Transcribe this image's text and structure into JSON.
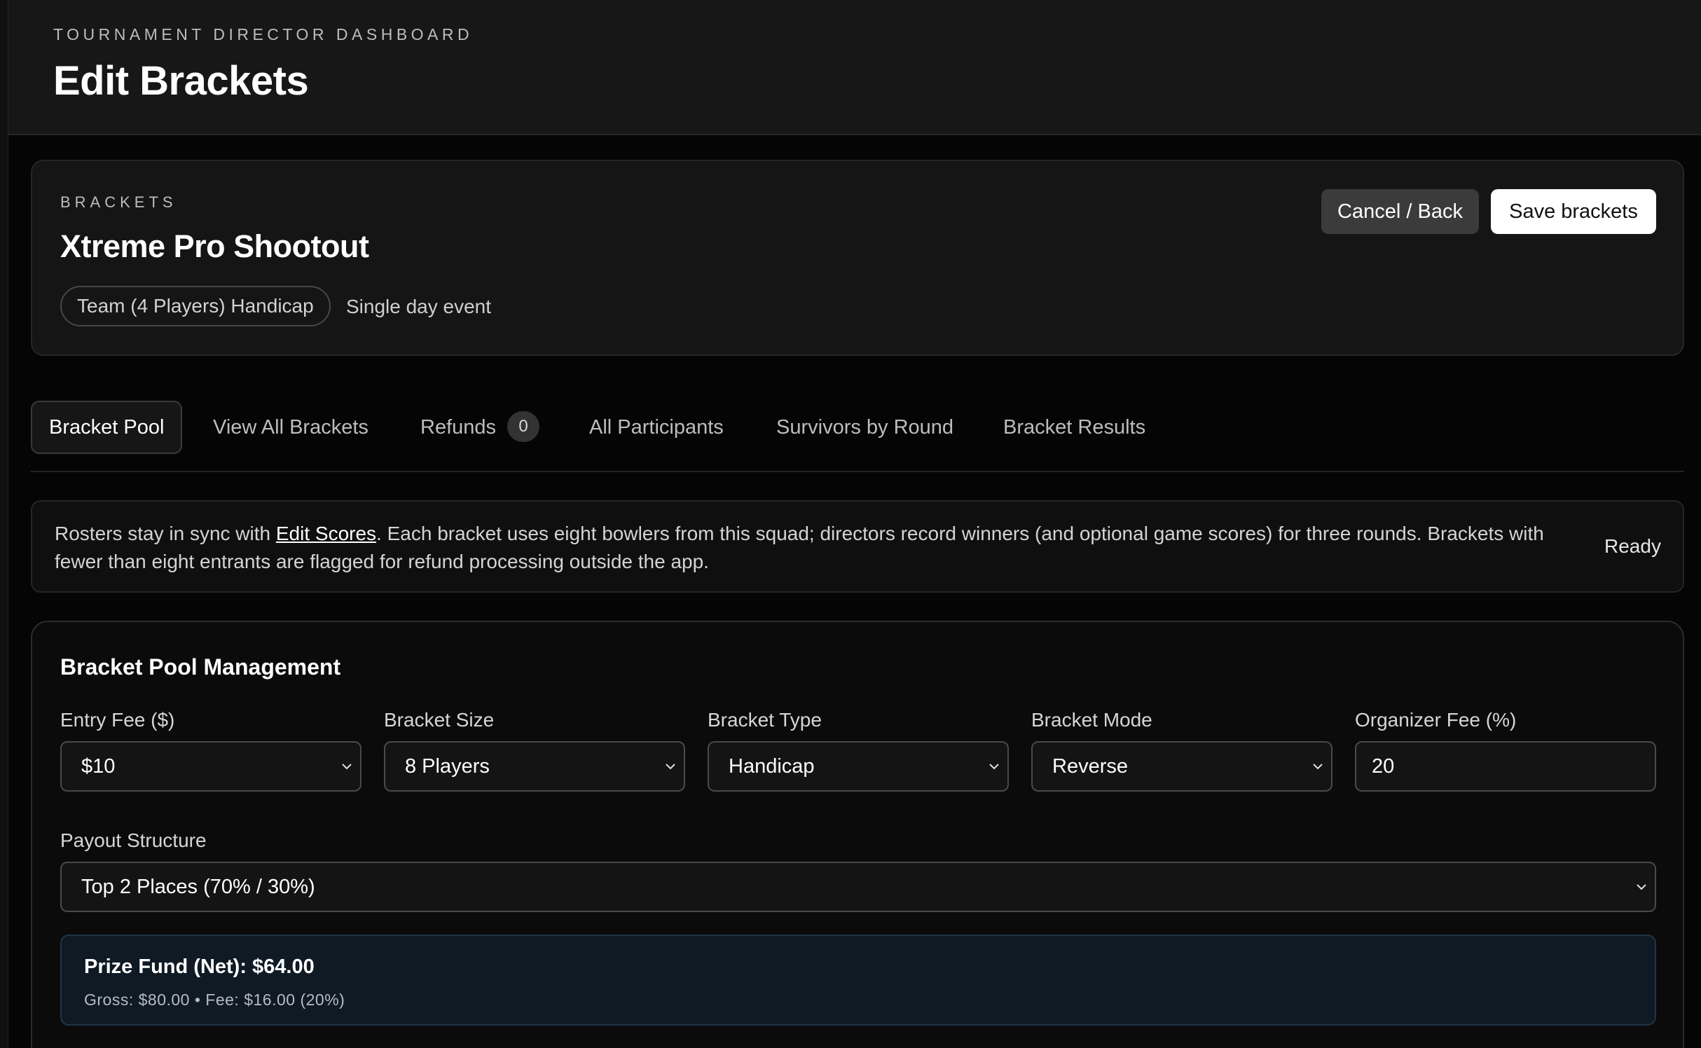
{
  "header": {
    "eyebrow": "TOURNAMENT DIRECTOR DASHBOARD",
    "title": "Edit Brackets"
  },
  "event": {
    "eyebrow": "BRACKETS",
    "name": "Xtreme Pro Shootout",
    "format_chip": "Team (4 Players) Handicap",
    "meta": "Single day event",
    "cancel_label": "Cancel / Back",
    "save_label": "Save brackets"
  },
  "tabs": [
    {
      "label": "Bracket Pool",
      "active": true
    },
    {
      "label": "View All Brackets"
    },
    {
      "label": "Refunds",
      "badge": "0"
    },
    {
      "label": "All Participants"
    },
    {
      "label": "Survivors by Round"
    },
    {
      "label": "Bracket Results"
    }
  ],
  "info": {
    "prefix": "Rosters stay in sync with ",
    "link": "Edit Scores",
    "suffix": ". Each bracket uses eight bowlers from this squad; directors record winners (and optional game scores) for three rounds. Brackets with fewer than eight entrants are flagged for refund processing outside the app.",
    "status": "Ready"
  },
  "pool": {
    "title": "Bracket Pool Management",
    "entry_fee": {
      "label": "Entry Fee ($)",
      "value": "$10"
    },
    "bracket_size": {
      "label": "Bracket Size",
      "value": "8 Players"
    },
    "bracket_type": {
      "label": "Bracket Type",
      "value": "Handicap"
    },
    "bracket_mode": {
      "label": "Bracket Mode",
      "value": "Reverse"
    },
    "organizer_fee": {
      "label": "Organizer Fee (%)",
      "value": "20"
    },
    "payout": {
      "label": "Payout Structure",
      "value": "Top 2 Places (70% / 30%)"
    },
    "prize": {
      "title": "Prize Fund (Net): $64.00",
      "detail": "Gross: $80.00 • Fee: $16.00 (20%)"
    }
  },
  "icons": {
    "dropdown": "chevron-down-icon"
  },
  "colors": {
    "background": "#050505",
    "panel": "#151515",
    "primary_button": "#ffffff",
    "secondary_button": "#3b3b3b",
    "prize_panel": "#0f1a24"
  }
}
